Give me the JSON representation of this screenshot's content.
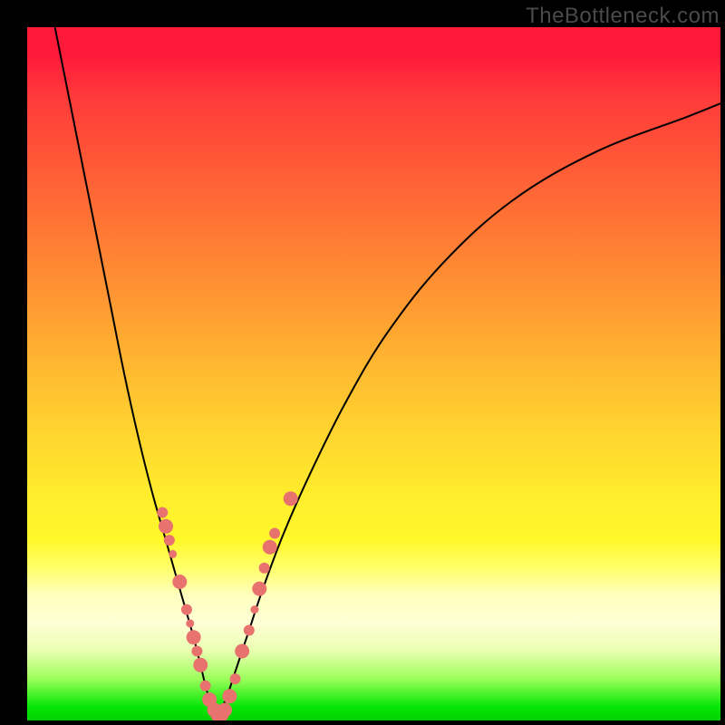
{
  "watermark": "TheBottleneck.com",
  "chart_data": {
    "type": "line",
    "title": "",
    "xlabel": "",
    "ylabel": "",
    "xlim": [
      0,
      100
    ],
    "ylim": [
      0,
      100
    ],
    "grid": false,
    "series": [
      {
        "name": "left-branch",
        "x": [
          4,
          6,
          8,
          10,
          12,
          14,
          16,
          18,
          20,
          22,
          24,
          25,
          26,
          27,
          27.5
        ],
        "y": [
          100,
          90,
          80,
          70,
          60,
          50,
          41,
          33,
          26,
          19,
          12,
          8,
          4,
          1.5,
          0.5
        ]
      },
      {
        "name": "right-branch",
        "x": [
          27.5,
          28,
          29,
          30,
          32,
          34,
          37,
          41,
          46,
          52,
          60,
          70,
          82,
          95,
          100
        ],
        "y": [
          0.5,
          1.5,
          4,
          7,
          13,
          19,
          27,
          36,
          46,
          56,
          66,
          75,
          82,
          87,
          89
        ]
      }
    ],
    "scatter_points": {
      "name": "sample-dots",
      "points": [
        {
          "x": 19.5,
          "y": 30,
          "size": "med"
        },
        {
          "x": 20.0,
          "y": 28,
          "size": "large"
        },
        {
          "x": 20.5,
          "y": 26,
          "size": "med"
        },
        {
          "x": 21.0,
          "y": 24,
          "size": "small"
        },
        {
          "x": 22.0,
          "y": 20,
          "size": "large"
        },
        {
          "x": 23.0,
          "y": 16,
          "size": "med"
        },
        {
          "x": 23.5,
          "y": 14,
          "size": "small"
        },
        {
          "x": 24.0,
          "y": 12,
          "size": "large"
        },
        {
          "x": 24.5,
          "y": 10,
          "size": "med"
        },
        {
          "x": 25.0,
          "y": 8,
          "size": "large"
        },
        {
          "x": 25.7,
          "y": 5,
          "size": "med"
        },
        {
          "x": 26.3,
          "y": 3,
          "size": "large"
        },
        {
          "x": 27.0,
          "y": 1.5,
          "size": "large"
        },
        {
          "x": 27.5,
          "y": 0.8,
          "size": "large"
        },
        {
          "x": 28.0,
          "y": 0.8,
          "size": "large"
        },
        {
          "x": 28.5,
          "y": 1.5,
          "size": "large"
        },
        {
          "x": 29.2,
          "y": 3.5,
          "size": "large"
        },
        {
          "x": 30.0,
          "y": 6,
          "size": "med"
        },
        {
          "x": 31.0,
          "y": 10,
          "size": "large"
        },
        {
          "x": 32.0,
          "y": 13,
          "size": "med"
        },
        {
          "x": 32.8,
          "y": 16,
          "size": "small"
        },
        {
          "x": 33.5,
          "y": 19,
          "size": "large"
        },
        {
          "x": 34.2,
          "y": 22,
          "size": "med"
        },
        {
          "x": 35.0,
          "y": 25,
          "size": "large"
        },
        {
          "x": 35.7,
          "y": 27,
          "size": "med"
        },
        {
          "x": 38.0,
          "y": 32,
          "size": "large"
        }
      ]
    },
    "gradient_stops": [
      {
        "pos": 0,
        "color": "#ff1a3a"
      },
      {
        "pos": 50,
        "color": "#ffd92e"
      },
      {
        "pos": 82,
        "color": "#ffffbf"
      },
      {
        "pos": 100,
        "color": "#00d000"
      }
    ]
  }
}
